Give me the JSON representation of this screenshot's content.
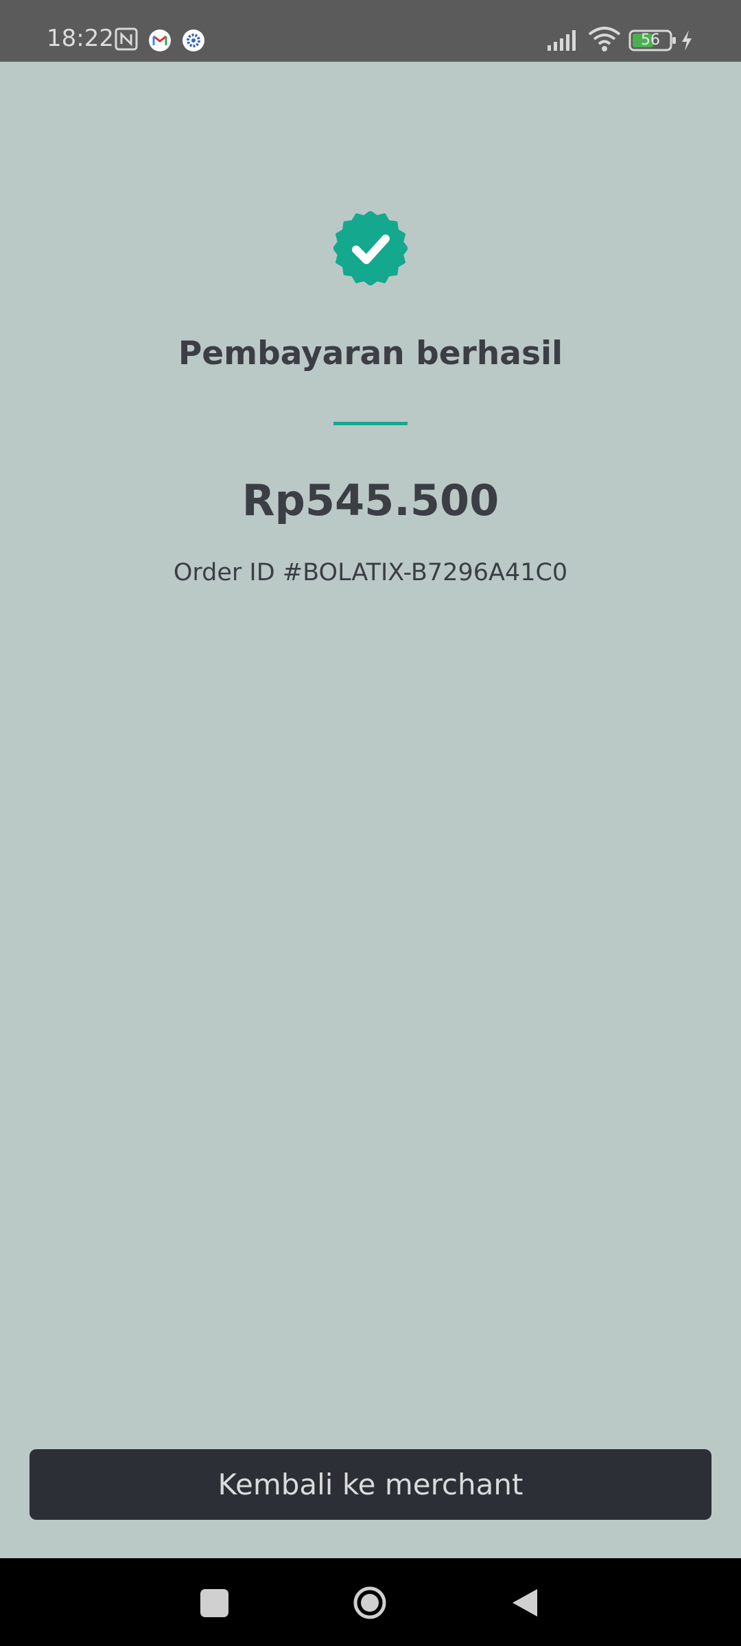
{
  "status_bar": {
    "time": "18:22",
    "battery_level": "56",
    "icons": [
      "nfc-icon",
      "gmail-icon",
      "app-icon",
      "signal-icon",
      "wifi-icon",
      "battery-icon",
      "charging-icon"
    ]
  },
  "payment": {
    "status_icon": "check-badge-icon",
    "title": "Pembayaran berhasil",
    "amount": "Rp545.500",
    "order_id": "Order ID #BOLATIX-B7296A41C0"
  },
  "actions": {
    "back_to_merchant_label": "Kembali ke merchant"
  },
  "nav_bar": {
    "icons": [
      "recents-icon",
      "home-icon",
      "back-icon"
    ]
  },
  "colors": {
    "accent": "#14a88e",
    "background": "#bbc9c6",
    "text": "#3b3e45",
    "button": "#2d2f36"
  }
}
